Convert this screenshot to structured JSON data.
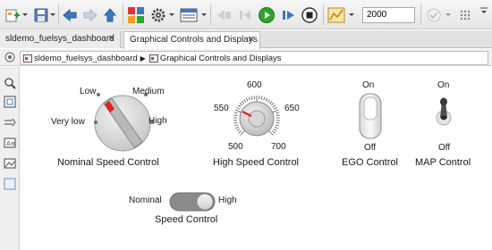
{
  "toolbar": {
    "stop_time": "2000"
  },
  "tabs": [
    {
      "label": "sldemo_fuelsys_dashboard",
      "active": false
    },
    {
      "label": "Graphical Controls and Displays",
      "active": true
    }
  ],
  "breadcrumb": {
    "items": [
      "sldemo_fuelsys_dashboard",
      "Graphical Controls and Displays"
    ]
  },
  "nominal_speed_control": {
    "title": "Nominal Speed Control",
    "states": [
      "Very low",
      "Low",
      "Medium",
      "High"
    ],
    "selected": "Low"
  },
  "high_speed_control": {
    "title": "High Speed Control",
    "ticks": [
      "500",
      "550",
      "600",
      "650",
      "700"
    ],
    "value": 550
  },
  "ego_control": {
    "title": "EGO Control",
    "on_label": "On",
    "off_label": "Off",
    "state": "On"
  },
  "map_control": {
    "title": "MAP Control",
    "on_label": "On",
    "off_label": "Off",
    "state": "On"
  },
  "speed_control": {
    "title": "Speed Control",
    "left_label": "Nominal",
    "right_label": "High",
    "state": "High"
  },
  "colors": {
    "run_green": "#2aa52a",
    "indicator_red": "#e02020",
    "toolbar_blue": "#3b78c2"
  }
}
